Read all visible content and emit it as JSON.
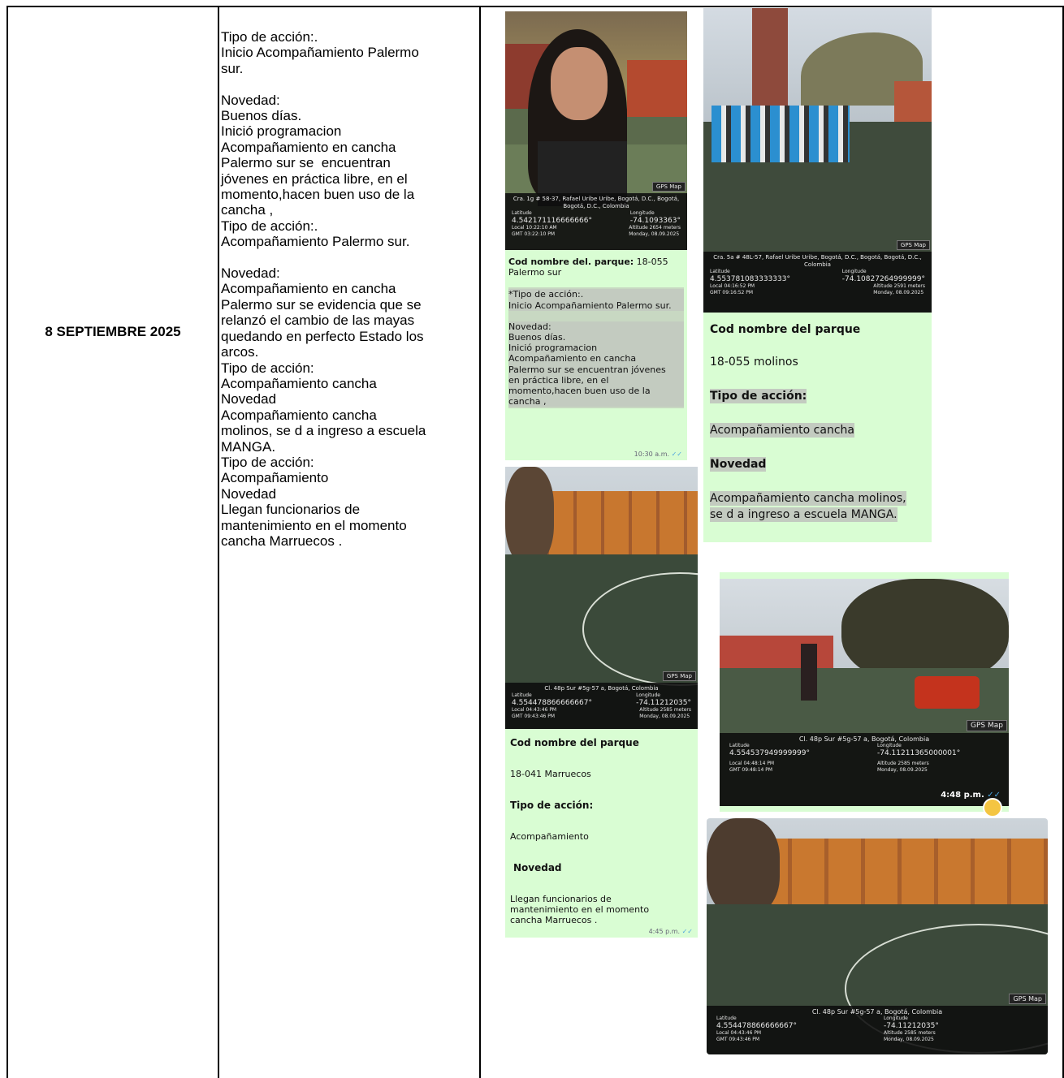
{
  "date": "8 SEPTIEMBRE 2025",
  "notes": [
    "Tipo de acción:.",
    "Inicio Acompañamiento Palermo",
    "sur.",
    "",
    "Novedad:",
    "Buenos días.",
    "Inició programacion",
    "Acompañamiento en cancha",
    "Palermo sur se  encuentran",
    "jóvenes en práctica libre, en el",
    "momento,hacen buen uso de la",
    "cancha ,",
    "Tipo de acción:.",
    "Acompañamiento Palermo sur.",
    "",
    "Novedad:",
    "Acompañamiento en cancha",
    "Palermo sur se evidencia que se",
    "relanzó el cambio de las mayas",
    "quedando en perfecto Estado los",
    "arcos.",
    "Tipo de acción:",
    "Acompañamiento cancha",
    "Novedad",
    "Acompañamiento cancha",
    "molinos, se d a ingreso a escuela",
    "MANGA.",
    "Tipo de acción:",
    "Acompañamiento",
    "Novedad",
    "Llegan funcionarios de",
    "mantenimiento en el momento",
    "cancha Marruecos ."
  ],
  "photo1": {
    "address": "Cra. 1g # 58-37, Rafael Uribe Uribe, Bogotá, D.C., Bogotá, Bogotá, D.C., Colombia",
    "lat_label": "Latitude",
    "lat": "4.542171116666666°",
    "lon_label": "Longitude",
    "lon": "-74.1093363°",
    "local": "Local 10:22:10 AM",
    "gmt": "GMT 03:22:10 PM",
    "altitude": "Altitude 2654 meters",
    "day": "Monday, 08.09.2025",
    "badge": "GPS Map"
  },
  "bubble1": {
    "title_bold": "Cod nombre del.  parque:",
    "title_rest": " 18-055",
    "line2": "Palermo sur",
    "quoted": [
      "*Tipo de acción:.",
      "Inicio Acompañamiento Palermo sur.",
      "",
      "Novedad:",
      "Buenos días.",
      "Inició programacion",
      "Acompañamiento en cancha",
      "Palermo sur se  encuentran jóvenes",
      "en práctica libre, en el",
      "momento,hacen buen uso de la",
      "cancha ,"
    ],
    "time": "10:30 a.m."
  },
  "photo2": {
    "address": "Cra. 5a # 48L-57, Rafael Uribe Uribe, Bogotá, D.C., Bogotá, Bogotá, D.C., Colombia",
    "lat_label": "Latitude",
    "lat": "4.553781083333333°",
    "lon_label": "Longitude",
    "lon": "-74.10827264999999°",
    "local": "Local 04:16:52 PM",
    "gmt": "GMT 09:16:52 PM",
    "altitude": "Altitude 2591 meters",
    "day": "Monday, 08.09.2025",
    "badge": "GPS Map"
  },
  "bubble2": {
    "h1": "Cod nombre del parque",
    "v1": "18-055 molinos",
    "h2": "Tipo de acción:",
    "v2": "Acompañamiento cancha",
    "h3": "Novedad",
    "v3a": "Acompañamiento cancha molinos,",
    "v3b": "se d a ingreso a escuela MANGA."
  },
  "photo3": {
    "address": "Cl. 48p Sur #5g-57 a, Bogotá, Colombia",
    "lat_label": "Latitude",
    "lat": "4.554478866666667°",
    "lon_label": "Longitude",
    "lon": "-74.11212035°",
    "local": "Local 04:43:46 PM",
    "gmt": "GMT 09:43:46 PM",
    "altitude": "Altitude 2585 meters",
    "day": "Monday, 08.09.2025",
    "badge": "GPS Map"
  },
  "bubble3": {
    "h1": "Cod nombre del parque",
    "v1": "18-041 Marruecos",
    "h2": "Tipo de acción:",
    "v2": "Acompañamiento",
    "h3": "Novedad",
    "v3": [
      "Llegan funcionarios de",
      "mantenimiento en el momento",
      "cancha Marruecos ."
    ],
    "time": "4:45 p.m."
  },
  "photo4": {
    "address": "Cl. 48p Sur #5g-57 a, Bogotá, Colombia",
    "lat_label": "Latitude",
    "lat": "4.554537949999999°",
    "lon_label": "Longitude",
    "lon": "-74.11211365000001°",
    "local": "Local 04:48:14 PM",
    "gmt": "GMT 09:48:14 PM",
    "altitude": "Altitude 2585 meters",
    "day": "Monday, 08.09.2025",
    "badge": "GPS Map",
    "time": "4:48 p.m."
  },
  "photo5": {
    "address": "Cl. 48p Sur #5g-57 a, Bogotá, Colombia",
    "lat_label": "Latitude",
    "lat": "4.554478866666667°",
    "lon_label": "Longitude",
    "lon": "-74.11212035°",
    "local": "Local 04:43:46 PM",
    "gmt": "GMT 09:43:46 PM",
    "altitude": "Altitude 2585 meters",
    "day": "Monday, 08.09.2025",
    "badge": "GPS Map"
  },
  "colors": {
    "bubble": "#d9fdd3",
    "field": "#3d4d3a",
    "border": "#000000"
  }
}
